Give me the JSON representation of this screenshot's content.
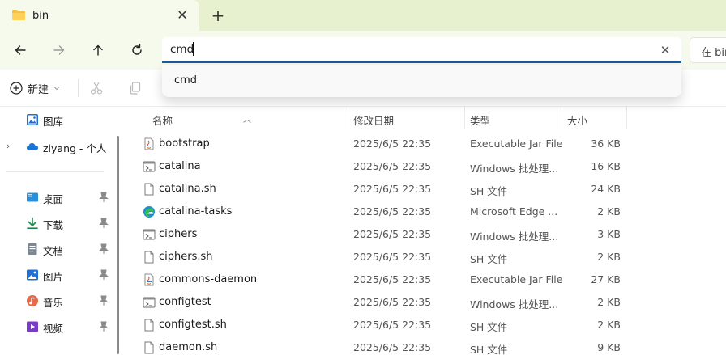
{
  "tab": {
    "title": "bin",
    "new_tab": "+",
    "close": "✕"
  },
  "nav": {
    "address_value": "cmd",
    "clear": "✕",
    "search_prefix": "在 bin"
  },
  "dropdown": {
    "suggestions": [
      "cmd"
    ]
  },
  "toolbar": {
    "new_label": "新建"
  },
  "sidebar": {
    "items": [
      {
        "label": "图库",
        "icon": "gallery-icon"
      },
      {
        "label": "ziyang - 个人",
        "icon": "cloud-icon"
      },
      {
        "label": "桌面",
        "icon": "desktop-icon",
        "pinned": true
      },
      {
        "label": "下载",
        "icon": "download-icon",
        "pinned": true
      },
      {
        "label": "文档",
        "icon": "document-icon",
        "pinned": true
      },
      {
        "label": "图片",
        "icon": "pictures-icon",
        "pinned": true
      },
      {
        "label": "音乐",
        "icon": "music-icon",
        "pinned": true
      },
      {
        "label": "视频",
        "icon": "video-icon",
        "pinned": true
      }
    ]
  },
  "columns": {
    "name": "名称",
    "date": "修改日期",
    "type": "类型",
    "size": "大小"
  },
  "files": [
    {
      "name": "bootstrap",
      "date": "2025/6/5 22:35",
      "type": "Executable Jar File",
      "size": "36 KB",
      "icon": "jar-icon"
    },
    {
      "name": "catalina",
      "date": "2025/6/5 22:35",
      "type": "Windows 批处理...",
      "size": "16 KB",
      "icon": "batch-file-icon"
    },
    {
      "name": "catalina.sh",
      "date": "2025/6/5 22:35",
      "type": "SH 文件",
      "size": "24 KB",
      "icon": "blank-file-icon"
    },
    {
      "name": "catalina-tasks",
      "date": "2025/6/5 22:35",
      "type": "Microsoft Edge ...",
      "size": "2 KB",
      "icon": "edge-icon"
    },
    {
      "name": "ciphers",
      "date": "2025/6/5 22:35",
      "type": "Windows 批处理...",
      "size": "3 KB",
      "icon": "batch-file-icon"
    },
    {
      "name": "ciphers.sh",
      "date": "2025/6/5 22:35",
      "type": "SH 文件",
      "size": "2 KB",
      "icon": "blank-file-icon"
    },
    {
      "name": "commons-daemon",
      "date": "2025/6/5 22:35",
      "type": "Executable Jar File",
      "size": "27 KB",
      "icon": "jar-icon"
    },
    {
      "name": "configtest",
      "date": "2025/6/5 22:35",
      "type": "Windows 批处理...",
      "size": "2 KB",
      "icon": "batch-file-icon"
    },
    {
      "name": "configtest.sh",
      "date": "2025/6/5 22:35",
      "type": "SH 文件",
      "size": "2 KB",
      "icon": "blank-file-icon"
    },
    {
      "name": "daemon.sh",
      "date": "2025/6/5 22:35",
      "type": "SH 文件",
      "size": "9 KB",
      "icon": "blank-file-icon"
    }
  ],
  "colors": {
    "accent": "#1b5b99",
    "tabbar": "#e7f1cf",
    "tab_active": "#f6faec"
  }
}
